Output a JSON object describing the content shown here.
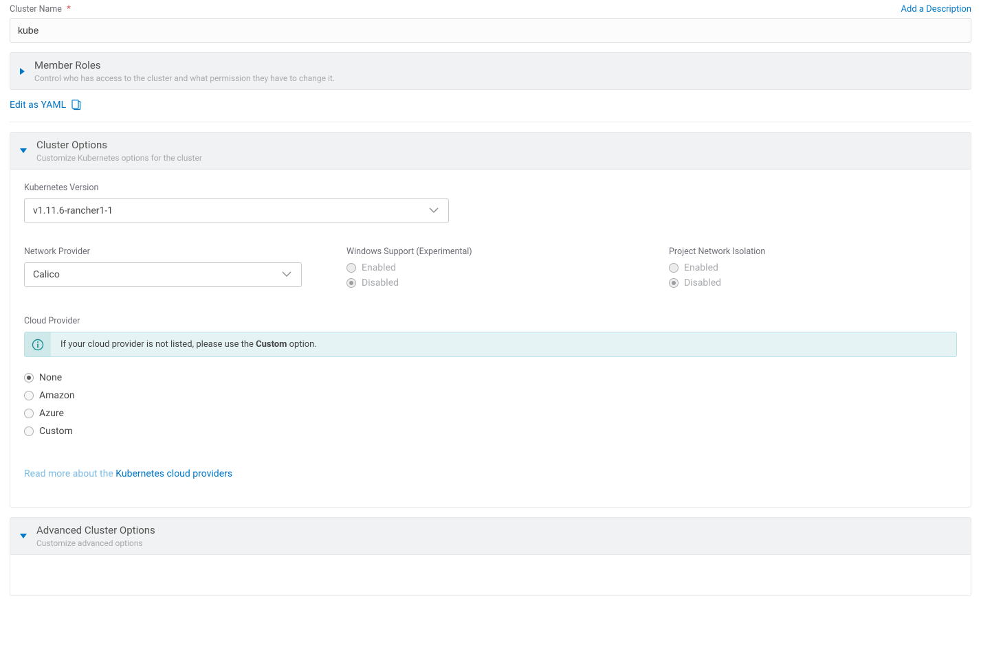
{
  "clusterName": {
    "label": "Cluster Name",
    "value": "kube",
    "addDescription": "Add a Description"
  },
  "memberRoles": {
    "title": "Member Roles",
    "sub": "Control who has access to the cluster and what permission they have to change it."
  },
  "editYaml": "Edit as YAML",
  "clusterOptions": {
    "title": "Cluster Options",
    "sub": "Customize Kubernetes options for the cluster",
    "k8sVersion": {
      "label": "Kubernetes Version",
      "value": "v1.11.6-rancher1-1"
    },
    "networkProvider": {
      "label": "Network Provider",
      "value": "Calico"
    },
    "windowsSupport": {
      "label": "Windows Support (Experimental)",
      "enabled": "Enabled",
      "disabled": "Disabled"
    },
    "projectNetworkIsolation": {
      "label": "Project Network Isolation",
      "enabled": "Enabled",
      "disabled": "Disabled"
    },
    "cloudProvider": {
      "label": "Cloud Provider",
      "bannerPrefix": "If your cloud provider is not listed, please use the ",
      "bannerBold": "Custom",
      "bannerSuffix": " option.",
      "options": {
        "none": "None",
        "amazon": "Amazon",
        "azure": "Azure",
        "custom": "Custom"
      },
      "readMorePrefix": "Read more about the ",
      "readMoreLink": "Kubernetes cloud providers"
    }
  },
  "advanced": {
    "title": "Advanced Cluster Options",
    "sub": "Customize advanced options"
  }
}
